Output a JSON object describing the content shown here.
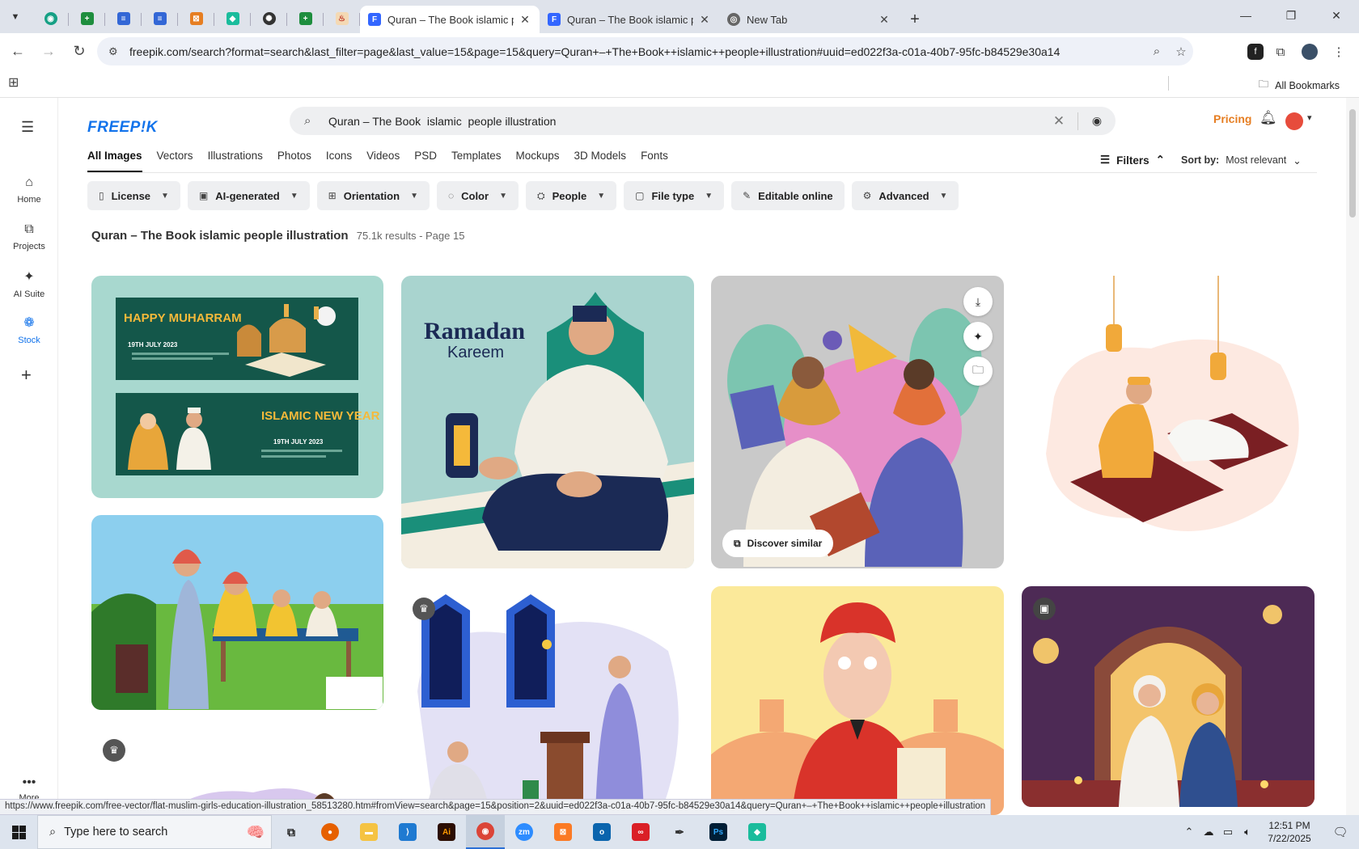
{
  "browser": {
    "tabs": [
      {
        "title": "Quran – The Book islamic peop",
        "active": true
      },
      {
        "title": "Quran – The Book islamic peop",
        "active": false
      },
      {
        "title": "New Tab",
        "active": false
      }
    ],
    "url": "freepik.com/search?format=search&last_filter=page&last_value=15&page=15&query=Quran+–+The+Book++islamic++people+illustration#uuid=ed022f3a-c01a-40b7-95fc-b84529e30a14",
    "all_bookmarks": "All Bookmarks",
    "status_url": "https://www.freepik.com/free-vector/flat-muslim-girls-education-illustration_58513280.htm#fromView=search&page=15&position=2&uuid=ed022f3a-c01a-40b7-95fc-b84529e30a14&query=Quran+–+The+Book++islamic++people+illustration"
  },
  "site": {
    "logo": "FREEP!K",
    "search_value": "Quran – The Book  islamic  people illustration",
    "pricing": "Pricing",
    "rail": [
      {
        "label": "Home",
        "icon": "home-icon"
      },
      {
        "label": "Projects",
        "icon": "projects-icon"
      },
      {
        "label": "AI Suite",
        "icon": "ai-suite-icon"
      },
      {
        "label": "Stock",
        "icon": "stock-icon"
      }
    ],
    "more": "More",
    "types": [
      "All Images",
      "Vectors",
      "Illustrations",
      "Photos",
      "Icons",
      "Videos",
      "PSD",
      "Templates",
      "Mockups",
      "3D Models",
      "Fonts"
    ],
    "filters_label": "Filters",
    "sort_label": "Sort by:",
    "sort_value": "Most relevant",
    "chips": [
      "License",
      "AI-generated",
      "Orientation",
      "Color",
      "People",
      "File type",
      "Editable online",
      "Advanced"
    ],
    "results_title": "Quran – The Book islamic people illustration",
    "results_meta": "75.1k results - Page 15",
    "card_texts": {
      "happy_muharram": "HAPPY MUHARRAM",
      "date1": "19TH JULY 2023",
      "islamic_new_year": "ISLAMIC NEW YEAR",
      "date2": "19TH JULY 2023",
      "ramadan": "Ramadan",
      "kareem": "Kareem"
    },
    "discover_similar": "Discover similar"
  },
  "taskbar": {
    "search_placeholder": "Type here to search",
    "time": "12:51 PM",
    "date": "7/22/2025"
  }
}
